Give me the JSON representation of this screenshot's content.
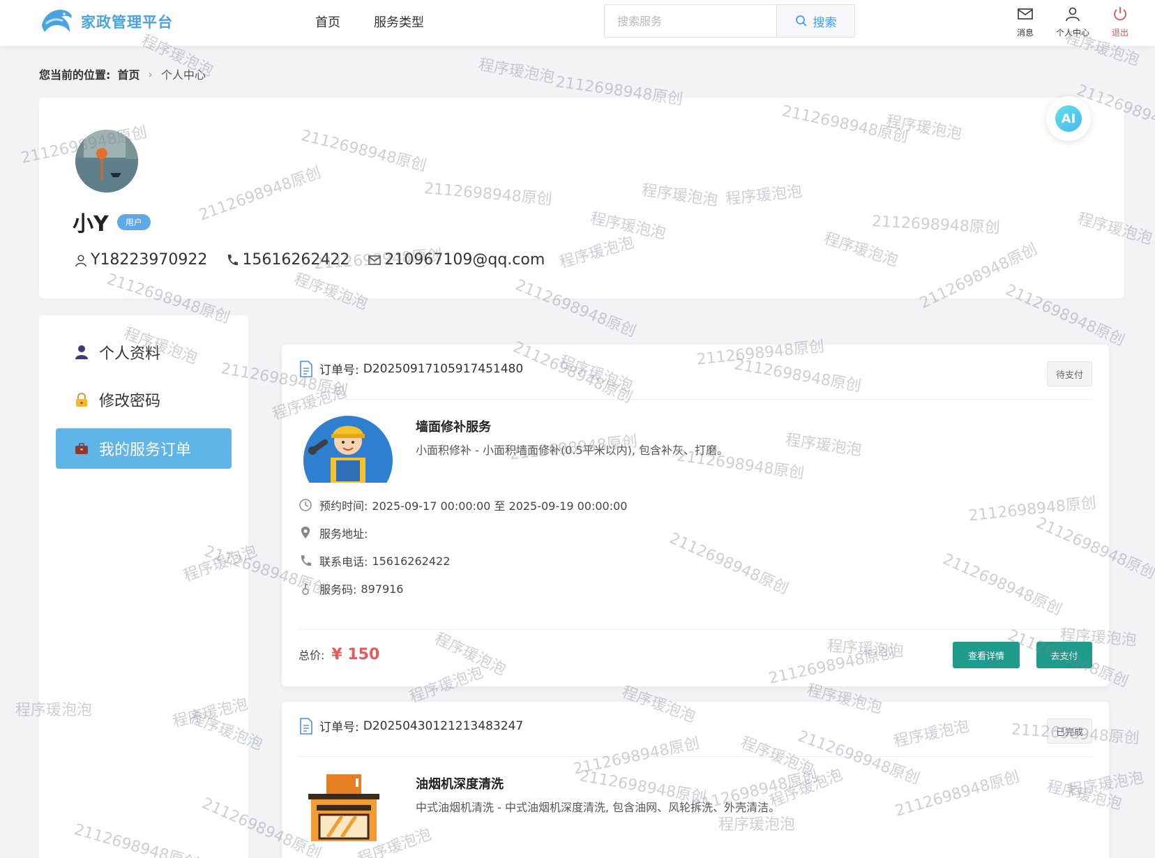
{
  "header": {
    "logo_text": "家政管理平台",
    "nav": [
      "首页",
      "服务类型"
    ],
    "search_placeholder": "搜索服务",
    "search_button": "搜索",
    "icons": {
      "messages": "消息",
      "profile": "个人中心",
      "logout": "退出"
    }
  },
  "breadcrumb": {
    "label": "您当前的位置:",
    "home": "首页",
    "current": "个人中心"
  },
  "profile": {
    "name": "小Y",
    "role_badge": "用户",
    "username": "Y18223970922",
    "phone": "15616262422",
    "email": "210967109@qq.com",
    "ai_label": "AI"
  },
  "sidebar": {
    "items": [
      {
        "label": "个人资料",
        "icon": "user-icon"
      },
      {
        "label": "修改密码",
        "icon": "lock-icon"
      },
      {
        "label": "我的服务订单",
        "icon": "briefcase-icon"
      }
    ]
  },
  "orders": [
    {
      "order_label": "订单号:",
      "order_no": "D20250917105917451480",
      "status": "待支付",
      "service_title": "墙面修补服务",
      "service_desc": "小面积修补 - 小面积墙面修补(0.5平米以内), 包含补灰、打磨。",
      "time_label": "预约时间:",
      "time_value": "2025-09-17 00:00:00 至 2025-09-19 00:00:00",
      "address_label": "服务地址:",
      "address_value": "",
      "phone_label": "联系电话:",
      "phone_value": "15616262422",
      "code_label": "服务码:",
      "code_value": "897916",
      "total_label": "总价:",
      "total_value": "¥ 150",
      "detail_button": "查看详情",
      "pay_button": "去支付"
    },
    {
      "order_label": "订单号:",
      "order_no": "D20250430121213483247",
      "status": "已完成",
      "service_title": "油烟机深度清洗",
      "service_desc": "中式油烟机清洗 - 中式油烟机深度清洗, 包含油网、风轮拆洗、外壳清洁。"
    }
  ],
  "watermarks": {
    "text_a": "程序瑗泡泡",
    "text_b": "2112698948原创"
  },
  "colors": {
    "brand": "#4aa3df",
    "accent": "#5fb4e8",
    "button": "#1f9b8c",
    "price": "#e65a5a",
    "logout": "#e2504c"
  }
}
